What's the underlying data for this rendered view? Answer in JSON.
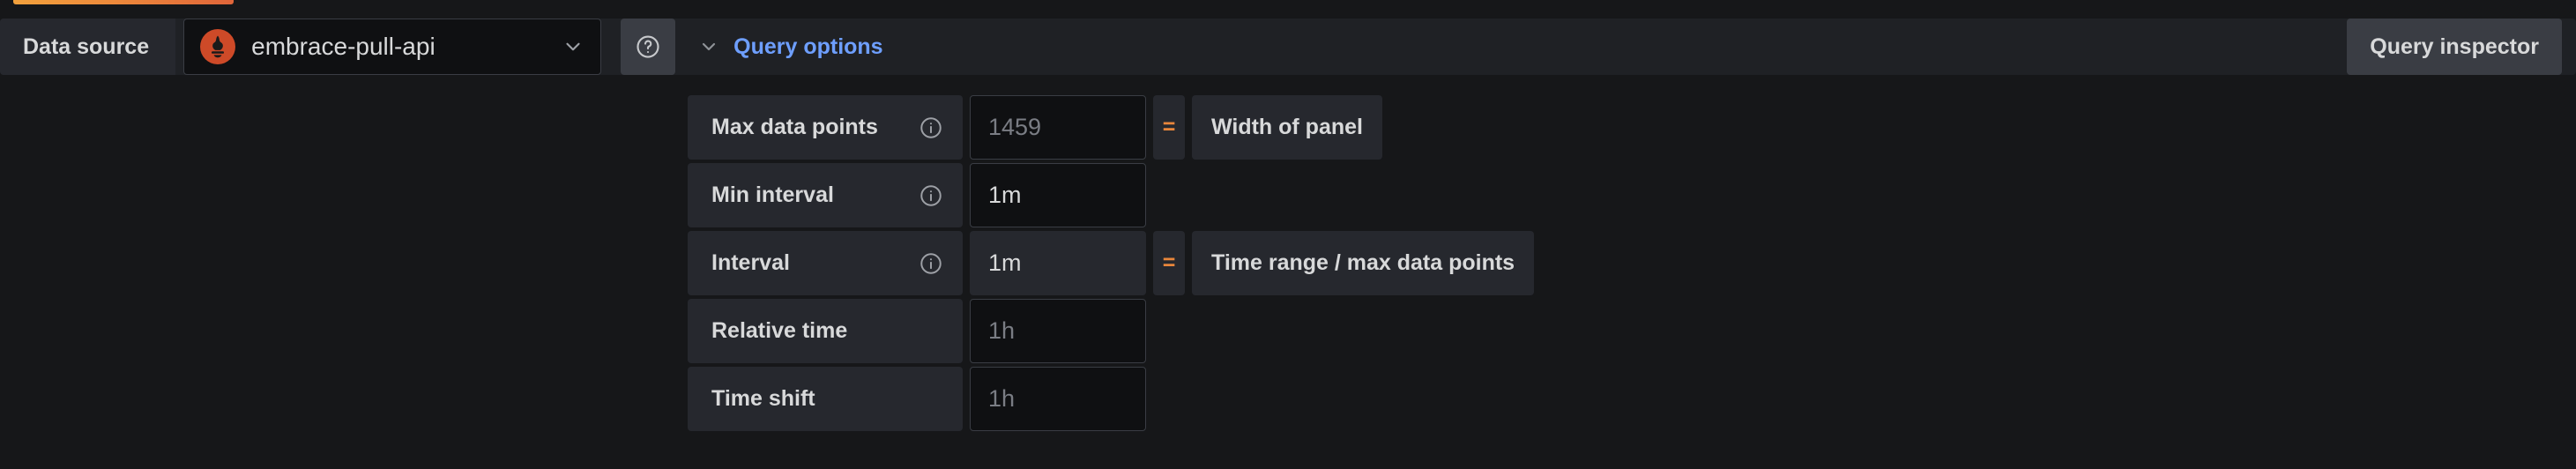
{
  "loading_bar": {
    "accent_color": "#E8863B",
    "visible": true
  },
  "toolbar": {
    "datasource_label": "Data source",
    "datasource_name": "embrace-pull-api",
    "datasource_icon": "prometheus-icon",
    "datasource_chevron_icon": "chevron-down-icon",
    "help_icon": "help-circle-icon",
    "query_options_chevron_icon": "chevron-down-icon",
    "query_options_label": "Query options",
    "query_inspector_label": "Query inspector"
  },
  "query_options": {
    "rows": [
      {
        "label": "Max data points",
        "info_icon": "info-circle-icon",
        "has_info": true,
        "value": "1459",
        "is_placeholder": true,
        "readonly": false,
        "equals": "=",
        "has_equals": true,
        "description": "Width of panel"
      },
      {
        "label": "Min interval",
        "info_icon": "info-circle-icon",
        "has_info": true,
        "value": "1m",
        "is_placeholder": false,
        "readonly": false,
        "equals": "",
        "has_equals": false,
        "description": ""
      },
      {
        "label": "Interval",
        "info_icon": "info-circle-icon",
        "has_info": true,
        "value": "1m",
        "is_placeholder": false,
        "readonly": true,
        "equals": "=",
        "has_equals": true,
        "description": "Time range / max data points"
      },
      {
        "label": "Relative time",
        "info_icon": "",
        "has_info": false,
        "value": "1h",
        "is_placeholder": true,
        "readonly": false,
        "equals": "",
        "has_equals": false,
        "description": ""
      },
      {
        "label": "Time shift",
        "info_icon": "",
        "has_info": false,
        "value": "1h",
        "is_placeholder": true,
        "readonly": false,
        "equals": "",
        "has_equals": false,
        "description": ""
      }
    ]
  },
  "colors": {
    "accent_blue": "#6E9FFF",
    "accent_orange": "#E8863B",
    "prometheus_orange": "#CE4A28",
    "background": "#161719",
    "panel": "#26282E",
    "input": "#0F1012"
  }
}
